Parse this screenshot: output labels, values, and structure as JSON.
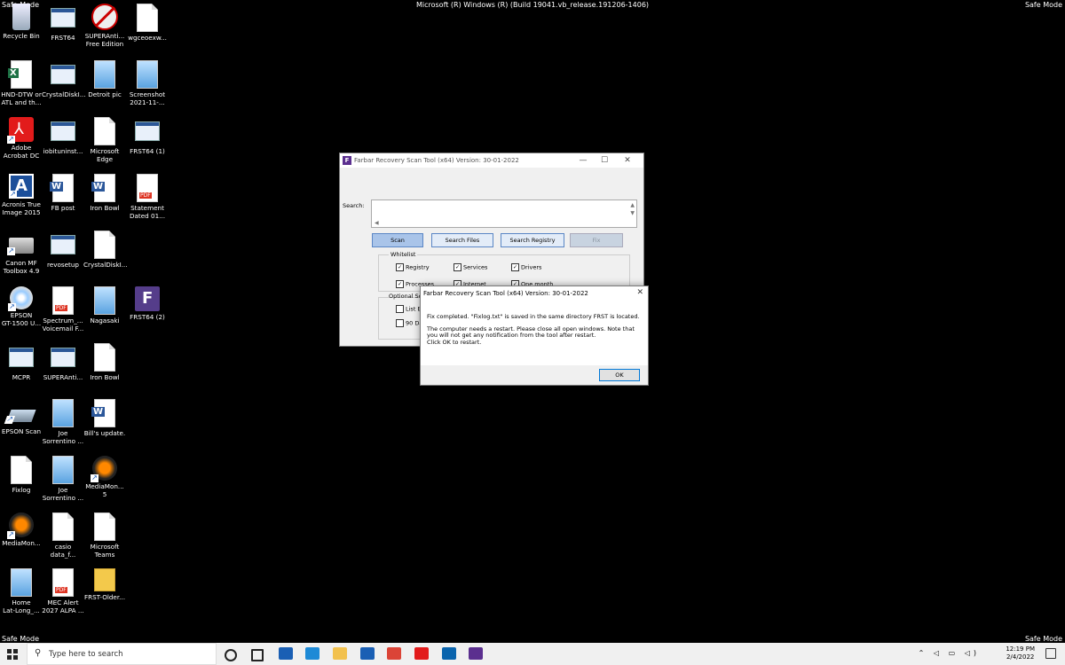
{
  "overlay": {
    "safe_mode": "Safe Mode",
    "build": "Microsoft (R) Windows (R) (Build 19041.vb_release.191206-1406)"
  },
  "desktop_icons": [
    {
      "label": "Recycle Bin",
      "icon": "recycle-bin-icon"
    },
    {
      "label": "FRST64",
      "icon": "frst-app-icon"
    },
    {
      "label": "SUPERAnti...\nFree Edition",
      "icon": "superantispyware-icon"
    },
    {
      "label": "wgceoexw...",
      "icon": "text-file-icon"
    },
    {
      "label": "HND-DTW or\nATL and th...",
      "icon": "excel-file-icon"
    },
    {
      "label": "CrystalDiskI...",
      "icon": "app-window-icon"
    },
    {
      "label": "Detroit pic",
      "icon": "image-file-icon"
    },
    {
      "label": "Screenshot\n2021-11-...",
      "icon": "image-file-icon"
    },
    {
      "label": "Adobe\nAcrobat DC",
      "icon": "acrobat-icon"
    },
    {
      "label": "iobituninst...",
      "icon": "app-window-icon"
    },
    {
      "label": "Microsoft\nEdge",
      "icon": "text-file-icon"
    },
    {
      "label": "FRST64 (1)",
      "icon": "app-window-icon"
    },
    {
      "label": "Acronis True\nImage 2015",
      "icon": "acronis-icon"
    },
    {
      "label": "FB post",
      "icon": "word-file-icon"
    },
    {
      "label": "Iron Bowl",
      "icon": "word-file-icon"
    },
    {
      "label": "Statement\nDated 01...",
      "icon": "pdf-file-icon"
    },
    {
      "label": "Canon MF\nToolbox 4.9",
      "icon": "printer-icon"
    },
    {
      "label": "revosetup",
      "icon": "app-window-icon"
    },
    {
      "label": "CrystalDiskI...",
      "icon": "text-file-icon"
    },
    {
      "label": "EPSON\nGT-1500 U...",
      "icon": "disc-icon"
    },
    {
      "label": "Spectrum_...\nVoicemail F...",
      "icon": "pdf-file-icon"
    },
    {
      "label": "Nagasaki",
      "icon": "image-file-icon"
    },
    {
      "label": "FRST64 (2)",
      "icon": "frst-purple-icon"
    },
    {
      "label": "MCPR",
      "icon": "app-window-icon"
    },
    {
      "label": "SUPERAnti...",
      "icon": "app-window-icon"
    },
    {
      "label": "Iron Bowl",
      "icon": "text-file-icon"
    },
    {
      "label": "EPSON Scan",
      "icon": "scanner-icon"
    },
    {
      "label": "Joe\nSorrentino ...",
      "icon": "image-file-icon"
    },
    {
      "label": "Bill's update.",
      "icon": "word-file-icon"
    },
    {
      "label": "Fixlog",
      "icon": "text-file-icon"
    },
    {
      "label": "Joe\nSorrentino ...",
      "icon": "image-file-icon"
    },
    {
      "label": "MediaMon...\n5",
      "icon": "mediamonkey-icon"
    },
    {
      "label": "MediaMon...",
      "icon": "mediamonkey-icon"
    },
    {
      "label": "casio\ndata_f...",
      "icon": "text-file-icon"
    },
    {
      "label": "Microsoft\nTeams",
      "icon": "text-file-icon"
    },
    {
      "label": "Home\nLat-Long_...",
      "icon": "image-file-icon"
    },
    {
      "label": "MEC Alert\n2027 ALPA ...",
      "icon": "pdf-file-icon"
    },
    {
      "label": "FRST-Older...",
      "icon": "folder-icon"
    }
  ],
  "frst_window": {
    "title": "Farbar Recovery Scan Tool (x64) Version: 30-01-2022",
    "min": "—",
    "max": "☐",
    "close": "✕",
    "search_label": "Search:",
    "buttons": {
      "scan": "Scan",
      "search_files": "Search Files",
      "search_registry": "Search Registry",
      "fix": "Fix"
    },
    "whitelist_label": "Whitelist",
    "whitelist": [
      {
        "label": "Registry",
        "checked": "✓"
      },
      {
        "label": "Services",
        "checked": "✓"
      },
      {
        "label": "Drivers",
        "checked": "✓"
      },
      {
        "label": "Processes",
        "checked": "✓"
      },
      {
        "label": "Internet",
        "checked": "✓"
      },
      {
        "label": "One month",
        "checked": "✓"
      }
    ],
    "optional_scan_label": "Optional Sca",
    "optional": [
      {
        "label": "List BC",
        "checked": ""
      },
      {
        "label": "90 Da",
        "checked": ""
      }
    ]
  },
  "dialog": {
    "title": "Farbar Recovery Scan Tool (x64) Version: 30-01-2022",
    "close": "✕",
    "line1": "Fix completed. \"Fixlog.txt\" is saved in the same directory FRST is located.",
    "line2": "The computer needs a restart. Please close all open windows. Note that you will not get any notification from the tool after restart.",
    "line3": "Click OK to restart.",
    "ok": "OK"
  },
  "taskbar": {
    "search_placeholder": "Type here to search",
    "time": "12:19 PM",
    "date": "2/4/2022",
    "tray": "⌃ ◁ ▭ ◁)",
    "pinned": [
      {
        "name": "cortana-icon",
        "color": "#222222"
      },
      {
        "name": "task-view-icon",
        "color": "#222222"
      },
      {
        "name": "store-icon",
        "color": "#1a5fb4"
      },
      {
        "name": "edge-icon",
        "color": "#1e8ad6"
      },
      {
        "name": "file-explorer-icon",
        "color": "#f2c14e"
      },
      {
        "name": "mail-icon",
        "color": "#1a5fb4"
      },
      {
        "name": "chrome-icon",
        "color": "#db4437"
      },
      {
        "name": "acrobat-taskbar-icon",
        "color": "#e21b1b"
      },
      {
        "name": "outlook-icon",
        "color": "#0a64ad"
      },
      {
        "name": "frst-taskbar-icon",
        "color": "#5b2f8f"
      }
    ]
  }
}
